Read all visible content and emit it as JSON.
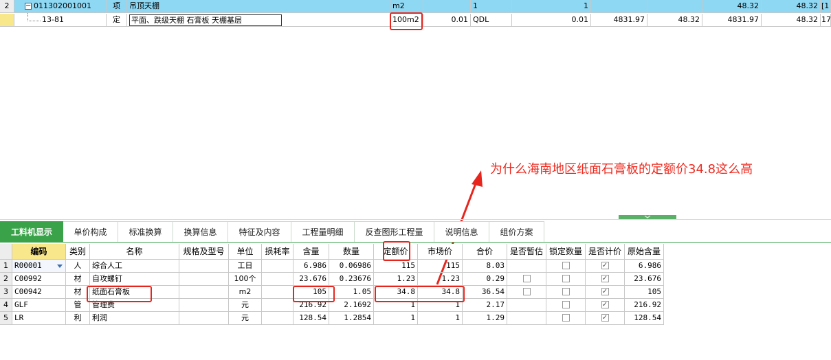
{
  "top_rows": [
    {
      "num": "2",
      "code": "011302001001",
      "type": "项",
      "name": "吊顶天棚",
      "unit": "m2",
      "qty_expr": "",
      "qty_expr2": "1",
      "qty": "1",
      "price": "",
      "total": "",
      "c10": "",
      "c11": "48.32",
      "c12": "48.32",
      "c13": "[1"
    },
    {
      "num": "",
      "code": "13-81",
      "type": "定",
      "name": "平面、跌级天棚 石膏板 天棚基层",
      "unit": "100m2",
      "qty_expr": "0.01",
      "qty_expr2": "QDL",
      "qty": "0.01",
      "price": "4831.97",
      "total": "48.32",
      "c10": "",
      "c11": "4831.97",
      "c12": "48.32",
      "c13": "17"
    }
  ],
  "tree_toggle": "−",
  "annotation": "为什么海南地区纸面石膏板的定额价34.8这么高",
  "tabs": [
    "工料机显示",
    "单价构成",
    "标准换算",
    "换算信息",
    "特征及内容",
    "工程量明细",
    "反查图形工程量",
    "说明信息",
    "组价方案"
  ],
  "grid_headers": [
    "编码",
    "类别",
    "名称",
    "规格及型号",
    "单位",
    "损耗率",
    "含量",
    "数量",
    "定额价",
    "市场价",
    "合价",
    "是否暂估",
    "锁定数量",
    "是否计价",
    "原始含量"
  ],
  "grid_rows": [
    {
      "num": "1",
      "code": "R00001",
      "type": "人",
      "name": "综合人工",
      "spec": "",
      "unit": "工日",
      "loss": "",
      "content": "6.986",
      "qty": "0.06986",
      "quota_price": "115",
      "market_price": "115",
      "total": "8.03",
      "provisional": null,
      "locked": false,
      "priced": true,
      "orig": "6.986"
    },
    {
      "num": "2",
      "code": "C00992",
      "type": "材",
      "name": "自攻螺钉",
      "spec": "",
      "unit": "100个",
      "loss": "",
      "content": "23.676",
      "qty": "0.23676",
      "quota_price": "1.23",
      "market_price": "1.23",
      "total": "0.29",
      "provisional": false,
      "locked": false,
      "priced": true,
      "orig": "23.676"
    },
    {
      "num": "3",
      "code": "C00942",
      "type": "材",
      "name": "纸面石膏板",
      "spec": "",
      "unit": "m2",
      "loss": "",
      "content": "105",
      "qty": "1.05",
      "quota_price": "34.8",
      "market_price": "34.8",
      "total": "36.54",
      "provisional": false,
      "locked": false,
      "priced": true,
      "orig": "105"
    },
    {
      "num": "4",
      "code": "GLF",
      "type": "管",
      "name": "管理费",
      "spec": "",
      "unit": "元",
      "loss": "",
      "content": "216.92",
      "qty": "2.1692",
      "quota_price": "1",
      "market_price": "1",
      "total": "2.17",
      "provisional": null,
      "locked": false,
      "priced": true,
      "orig": "216.92"
    },
    {
      "num": "5",
      "code": "LR",
      "type": "利",
      "name": "利润",
      "spec": "",
      "unit": "元",
      "loss": "",
      "content": "128.54",
      "qty": "1.2854",
      "quota_price": "1",
      "market_price": "1",
      "total": "1.29",
      "provisional": null,
      "locked": false,
      "priced": true,
      "orig": "128.54"
    }
  ],
  "colors": {
    "selected_row": "#8ed8f4",
    "tab_active": "#3aa34a",
    "highlight": "#e8251d",
    "header_code": "#f9e78c"
  }
}
